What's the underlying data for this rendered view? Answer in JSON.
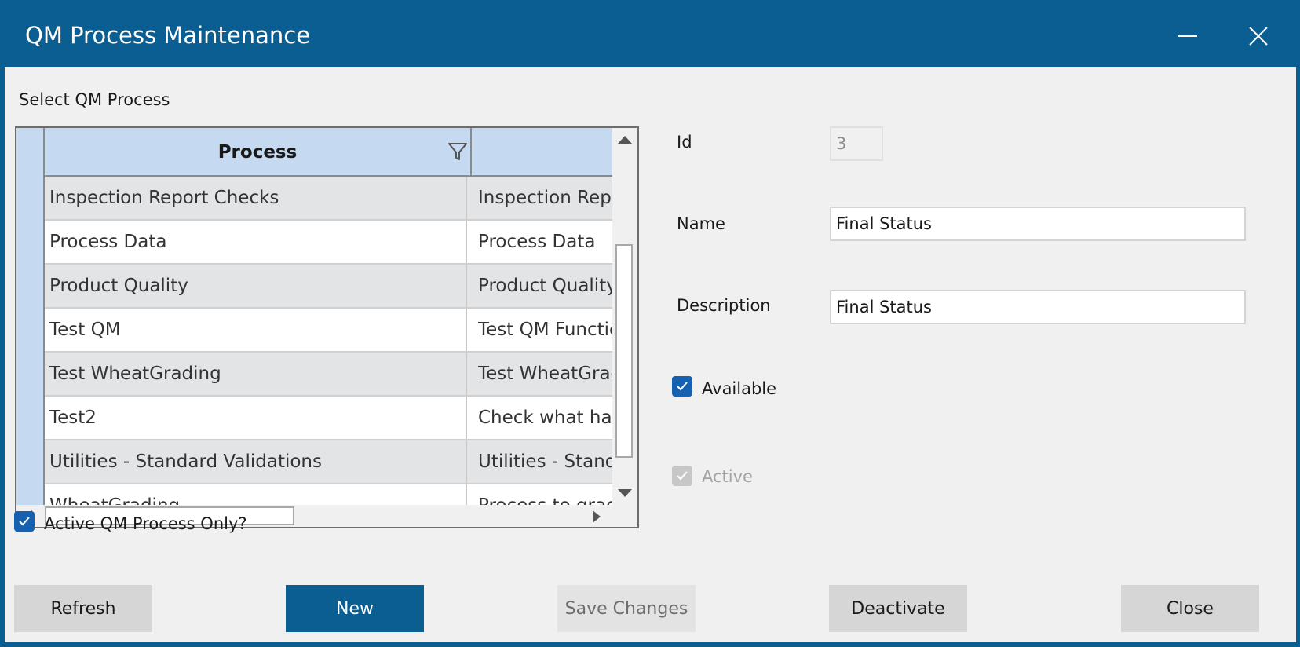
{
  "window": {
    "title": "QM Process Maintenance",
    "colors": {
      "titlebar": "#0b5e92",
      "accent": "#1560b0",
      "client_bg": "#f0f0f0"
    }
  },
  "grid": {
    "label": "Select QM Process",
    "columns": [
      "Process",
      ""
    ],
    "rows": [
      {
        "process": "Inspection Report Checks",
        "description": "Inspection Repo"
      },
      {
        "process": "Process Data",
        "description": "Process Data"
      },
      {
        "process": "Product Quality",
        "description": "Product Quality"
      },
      {
        "process": "Test QM",
        "description": "Test QM Functic"
      },
      {
        "process": "Test WheatGrading",
        "description": "Test WheatGradi"
      },
      {
        "process": "Test2",
        "description": "Check what hap"
      },
      {
        "process": "Utilities - Standard Validations",
        "description": "Utilities - Standa"
      },
      {
        "process": "WheatGrading",
        "description": "Process to grade"
      }
    ]
  },
  "filter": {
    "active_only_label": "Active QM Process Only?",
    "active_only_checked": true
  },
  "form": {
    "id_label": "Id",
    "id_value": "3",
    "name_label": "Name",
    "name_value": "Final Status",
    "description_label": "Description",
    "description_value": "Final Status",
    "available_label": "Available",
    "available_checked": true,
    "active_label": "Active",
    "active_checked": true
  },
  "buttons": {
    "refresh": "Refresh",
    "new": "New",
    "save": "Save Changes",
    "deactivate": "Deactivate",
    "close": "Close"
  }
}
